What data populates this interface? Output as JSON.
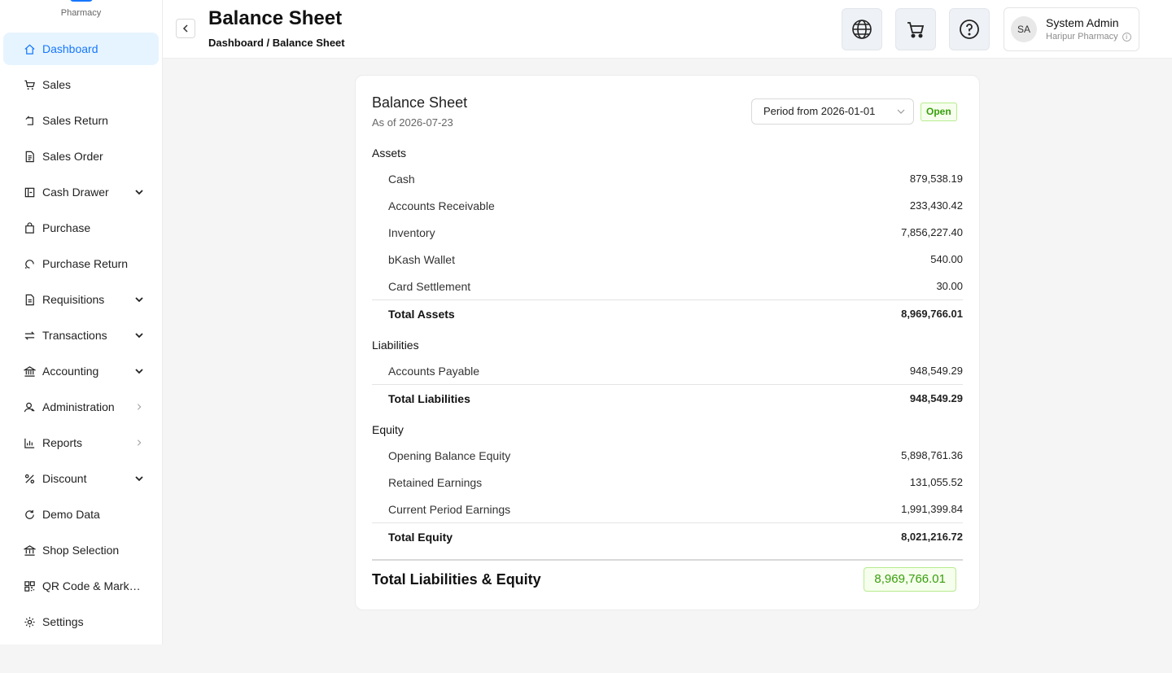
{
  "brand": {
    "subtitle": "Pharmacy"
  },
  "sidebar": {
    "items": [
      {
        "label": "Dashboard",
        "icon": "home-icon",
        "active": true,
        "chevron": ""
      },
      {
        "label": "Sales",
        "icon": "cart-icon",
        "chevron": ""
      },
      {
        "label": "Sales Return",
        "icon": "return-icon",
        "chevron": ""
      },
      {
        "label": "Sales Order",
        "icon": "document-icon",
        "chevron": ""
      },
      {
        "label": "Cash Drawer",
        "icon": "cash-drawer-icon",
        "chevron": "down"
      },
      {
        "label": "Purchase",
        "icon": "shopping-bag-icon",
        "chevron": ""
      },
      {
        "label": "Purchase Return",
        "icon": "rotate-icon",
        "chevron": ""
      },
      {
        "label": "Requisitions",
        "icon": "file-icon",
        "chevron": "down"
      },
      {
        "label": "Transactions",
        "icon": "swap-icon",
        "chevron": "down"
      },
      {
        "label": "Accounting",
        "icon": "bank-icon",
        "chevron": "down"
      },
      {
        "label": "Administration",
        "icon": "user-admin-icon",
        "chevron": "right"
      },
      {
        "label": "Reports",
        "icon": "bar-chart-icon",
        "chevron": "right"
      },
      {
        "label": "Discount",
        "icon": "percent-icon",
        "chevron": "down"
      },
      {
        "label": "Demo Data",
        "icon": "reload-icon",
        "chevron": ""
      },
      {
        "label": "Shop Selection",
        "icon": "shop-icon",
        "chevron": ""
      },
      {
        "label": "QR Code & Marketi...",
        "icon": "qrcode-icon",
        "chevron": ""
      },
      {
        "label": "Settings",
        "icon": "gear-icon",
        "chevron": ""
      }
    ]
  },
  "header": {
    "title": "Balance Sheet",
    "breadcrumb": "Dashboard / Balance Sheet",
    "user": {
      "initials": "SA",
      "name": "System Admin",
      "shop": "Haripur Pharmacy"
    }
  },
  "report": {
    "title": "Balance Sheet",
    "as_of": "As of 2026-07-23",
    "period": "Period from 2026-01-01",
    "status": "Open",
    "assets": {
      "heading": "Assets",
      "rows": [
        {
          "name": "Cash",
          "amount": "879,538.19"
        },
        {
          "name": "Accounts Receivable",
          "amount": "233,430.42"
        },
        {
          "name": "Inventory",
          "amount": "7,856,227.40"
        },
        {
          "name": "bKash Wallet",
          "amount": "540.00"
        },
        {
          "name": "Card Settlement",
          "amount": "30.00"
        }
      ],
      "total_label": "Total Assets",
      "total": "8,969,766.01"
    },
    "liabilities": {
      "heading": "Liabilities",
      "rows": [
        {
          "name": "Accounts Payable",
          "amount": "948,549.29"
        }
      ],
      "total_label": "Total Liabilities",
      "total": "948,549.29"
    },
    "equity": {
      "heading": "Equity",
      "rows": [
        {
          "name": "Opening Balance Equity",
          "amount": "5,898,761.36"
        },
        {
          "name": "Retained Earnings",
          "amount": "131,055.52"
        },
        {
          "name": "Current Period Earnings",
          "amount": "1,991,399.84"
        }
      ],
      "total_label": "Total Equity",
      "total": "8,021,216.72"
    },
    "grand_total_label": "Total Liabilities & Equity",
    "grand_total": "8,969,766.01"
  },
  "colors": {
    "accent": "#1677ff",
    "success": "#389e0d"
  }
}
